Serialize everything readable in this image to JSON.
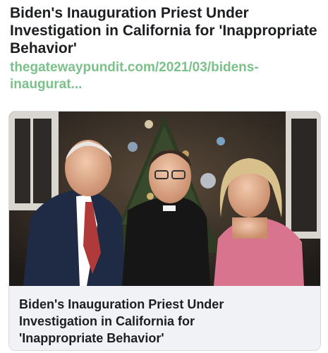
{
  "post": {
    "title_lines": [
      "Biden's Inauguration Priest Under",
      "Investigation in California for 'Inappropriate",
      "Behavior'"
    ],
    "link_lines": [
      "thegatewaypundit.com/2021/03/bidens-",
      "inaugurat..."
    ]
  },
  "card": {
    "title_lines": [
      "Biden's Inauguration Priest Under",
      "Investigation in California for",
      "'Inappropriate Behavior'"
    ]
  }
}
